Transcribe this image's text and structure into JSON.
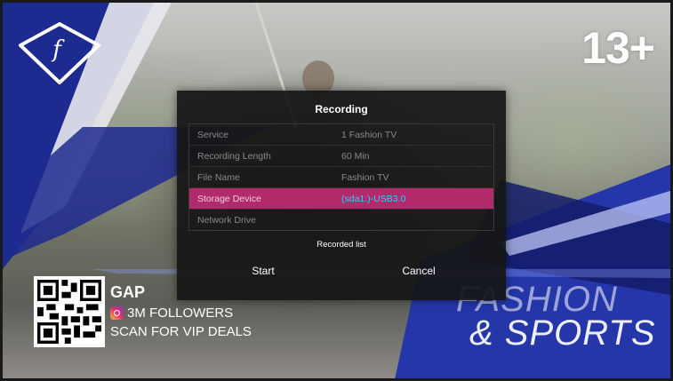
{
  "channel": {
    "logo_letter": "f",
    "age_rating": "13+",
    "brand_line1": "FASHION",
    "brand_line2": "& SPORTS"
  },
  "promo": {
    "title": "GAP",
    "followers": "3M FOLLOWERS",
    "cta": "SCAN FOR VIP DEALS",
    "icon": "instagram-icon"
  },
  "dialog": {
    "title": "Recording",
    "rows": [
      {
        "label": "Service",
        "value": "1 Fashion TV"
      },
      {
        "label": "Recording Length",
        "value": "60 Min"
      },
      {
        "label": "File Name",
        "value": "Fashion TV"
      },
      {
        "label": "Storage Device",
        "value": "(sda1:)-USB3.0"
      },
      {
        "label": "Network Drive",
        "value": ""
      }
    ],
    "selected_row": "Storage Device",
    "recorded_list_label": "Recorded list",
    "start_label": "Start",
    "cancel_label": "Cancel"
  },
  "colors": {
    "selection": "#b32a6c",
    "selected_value": "#2bd2ff",
    "brand_blue": "#1f2a8c"
  }
}
